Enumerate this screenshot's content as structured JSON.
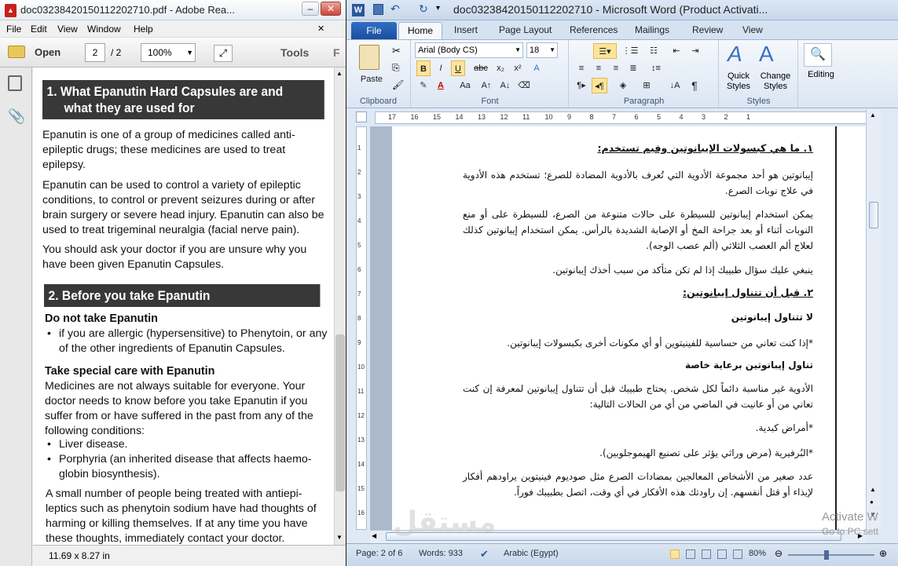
{
  "reader": {
    "title": "doc03238420150112202710.pdf - Adobe Rea...",
    "menu": [
      "File",
      "Edit",
      "View",
      "Window",
      "Help"
    ],
    "open_label": "Open",
    "page_current": "2",
    "page_total": "/ 2",
    "zoom": "100%",
    "tools_label": "Tools",
    "status_size": "11.69 x 8.27 in",
    "content": {
      "h1": "1. What Epanutin Hard Capsules are and",
      "h1b": "what they are used for",
      "p1": "Epanutin is one of a group of medicines called anti-epileptic drugs; these medicines are used to treat epilepsy.",
      "p2": "Epanutin can be used to control a variety of epileptic conditions, to control or prevent seizures during or after brain surgery or severe head injury. Epanutin can also be used to treat trigeminal neuralgia (facial nerve pain).",
      "p3": "You should ask your doctor if you are unsure why you have been given Epanutin Capsules.",
      "h2": "2. Before you take Epanutin",
      "sub1": "Do not take Epanutin",
      "bullet1": "if you are allergic (hypersensitive) to Phenytoin, or any of the other ingredients of Epanutin Capsules.",
      "sub2": "Take special care with Epanutin",
      "p4": "Medicines are not always suitable for everyone. Your doctor needs to know before you take Epanutin if you suffer from or have suffered in the past from any of the following conditions:",
      "bullet2": "Liver disease.",
      "bullet3": "Porphyria (an inherited disease that affects haemo-globin biosynthesis).",
      "p5": "A small number of people being treated with antiepi-leptics such as phenytoin sodium have had thoughts of harming or killing themselves. If at any time you have these thoughts, immediately contact your doctor."
    }
  },
  "word": {
    "title": "doc03238420150112202710 - Microsoft Word (Product Activati...",
    "tabs": {
      "file": "File",
      "home": "Home",
      "insert": "Insert",
      "page_layout": "Page Layout",
      "references": "References",
      "mailings": "Mailings",
      "review": "Review",
      "view": "View"
    },
    "ribbon": {
      "paste": "Paste",
      "font_name": "Arial (Body CS)",
      "font_size": "18",
      "quick_styles": "Quick Styles",
      "change_styles": "Change Styles",
      "editing": "Editing",
      "groups": {
        "clipboard": "Clipboard",
        "font": "Font",
        "paragraph": "Paragraph",
        "styles": "Styles"
      }
    },
    "ruler_numbers": [
      "17",
      "16",
      "15",
      "14",
      "13",
      "12",
      "11",
      "10",
      "9",
      "8",
      "7",
      "6",
      "5",
      "4",
      "3",
      "2",
      "1"
    ],
    "ruler_left_numbers": [
      "1",
      "2",
      "3",
      "4",
      "5",
      "6",
      "7",
      "8",
      "9",
      "10",
      "11",
      "12",
      "13",
      "14",
      "15",
      "16"
    ],
    "content": {
      "h1": "١. ما هي كبسولات الإيبانوتين وفيم تستخدم:",
      "p1": "إيبانوتين هو أحد مجموعة الأدوية التي تُعرف بالأدوية المضادة للصرع؛ تستخدم هذه الأدوية في علاج نوبات الصرع.",
      "p2": "يمكن استخدام إيبانوتين للسيطرة على حالات متنوعة من الصرع، للسيطرة على أو منع النوبات أثناء أو بعد جراحة المخ أو الإصابة الشديدة بالرأس. يمكن استخدام إيبانوتين كذلك لعلاج ألم العصب الثلاثي (ألم عصب الوجه).",
      "p3": "ينبغي عليك سؤال طبيبك إذا لم تكن متأكد من سبب أخذك إيبانوتين.",
      "h2": "٢. قبل أن تتناول إيبانوتين:",
      "sub1": "لا تتناول إيبانوتين",
      "p4": "*إذا كنت تعاني من حساسية للفينيتوين أو أي مكونات أخرى بكبسولات إيبانوتين.",
      "sub2": "تناول إيبانوتين برعاية خاصة",
      "p5": "الأدوية غير مناسبة دائماً لكل شخص. يحتاج طبيبك قبل أن تتناول إيبانوتين لمعرفة إن كنت تعاني من أو عانيت في الماضي من أي من الحالات التالية:",
      "p6": "*أمراض كبدية.",
      "p7": "*البُرفيرية (مرض وراثي يؤثر على تصنيع الهيموجلوبين).",
      "p8": "عدد صغير من الأشخاص المعالجين بمضادات الصرع مثل صوديوم فينيتوين يراودهم أفكار لإيذاء أو قتل أنفسهم. إن راودتك هذه الأفكار في أي وقت، اتصل بطبيبك فوراً."
    },
    "status": {
      "page": "Page: 2 of 6",
      "words": "Words: 933",
      "language": "Arabic (Egypt)",
      "zoom": "80%"
    }
  },
  "overlay": {
    "watermark": "مستقل",
    "activate1": "Activate W",
    "activate2": "Go to PC sett"
  },
  "colors": {
    "word_blue": "#2b579a",
    "reader_red": "#c8201c",
    "pdf_bar": "#383838"
  }
}
